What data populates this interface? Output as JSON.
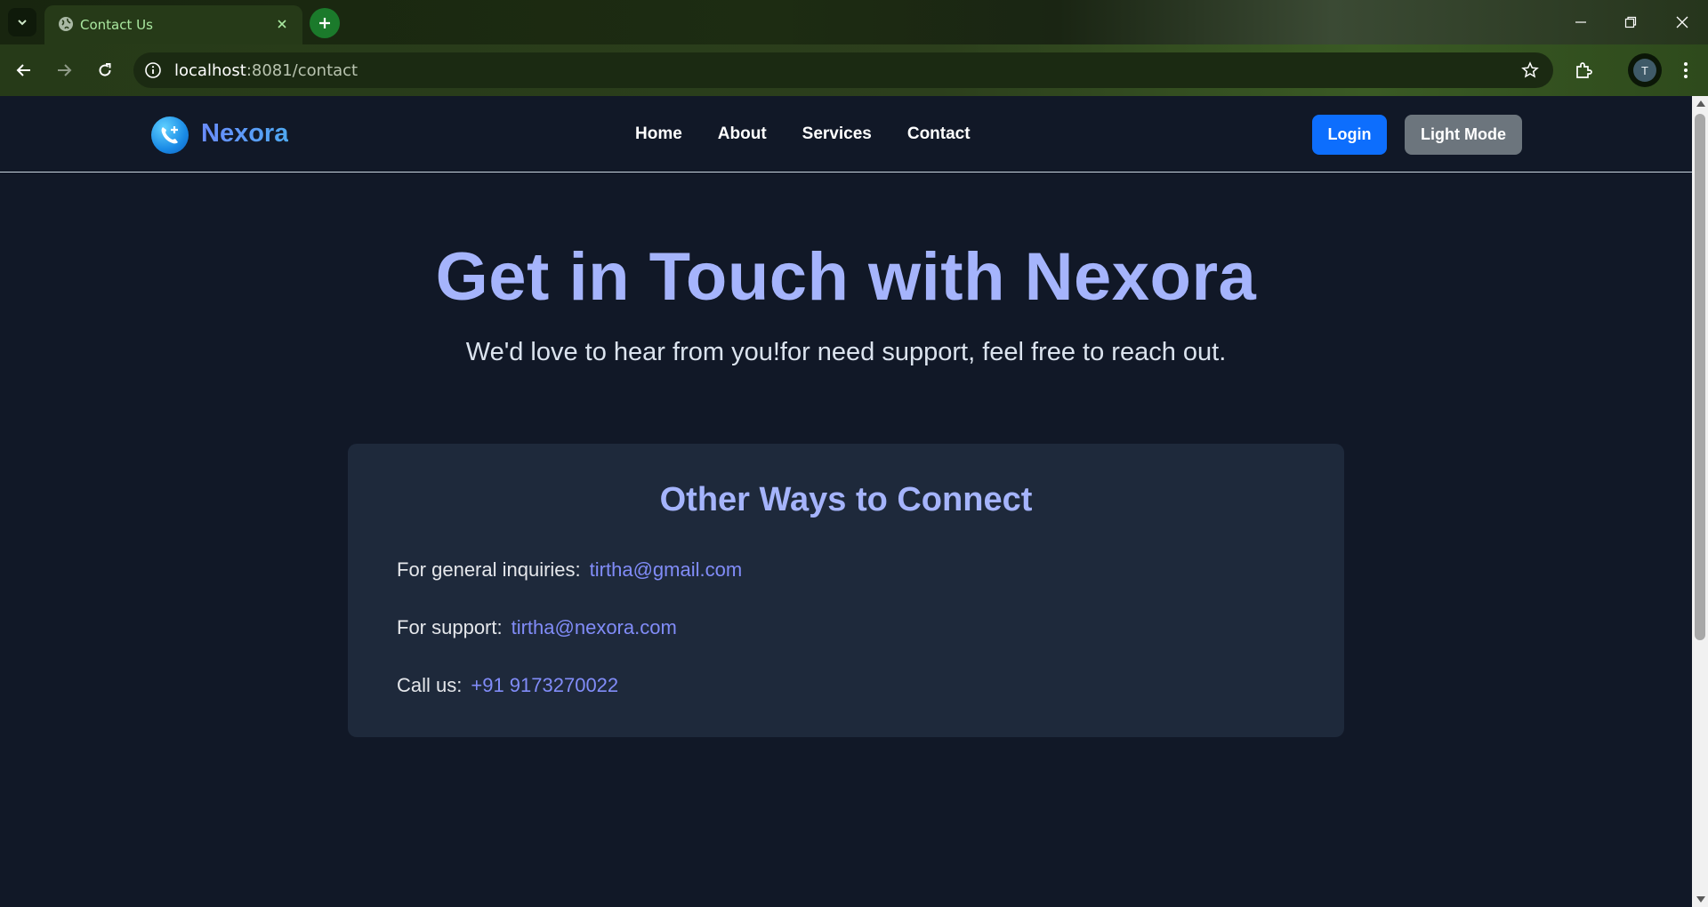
{
  "browser": {
    "tab_title": "Contact Us",
    "url_host": "localhost",
    "url_path": ":8081/contact",
    "profile_initial": "T"
  },
  "site": {
    "brand": "Nexora",
    "nav": [
      "Home",
      "About",
      "Services",
      "Contact"
    ],
    "login_label": "Login",
    "mode_label": "Light Mode"
  },
  "hero": {
    "title": "Get in Touch with Nexora",
    "subtitle": "We'd love to hear from you!for need support, feel free to reach out."
  },
  "connect": {
    "title": "Other Ways to Connect",
    "rows": [
      {
        "label": "For general inquiries:",
        "value": "tirtha@gmail.com"
      },
      {
        "label": "For support:",
        "value": "tirtha@nexora.com"
      },
      {
        "label": "Call us:",
        "value": "+91 9173270022"
      }
    ]
  },
  "colors": {
    "page_bg": "#111827",
    "card_bg": "#1e293b",
    "accent_heading": "#a5b4fc",
    "link": "#818cf8",
    "login_button": "#0d6efd",
    "mode_button": "#6c757d"
  }
}
